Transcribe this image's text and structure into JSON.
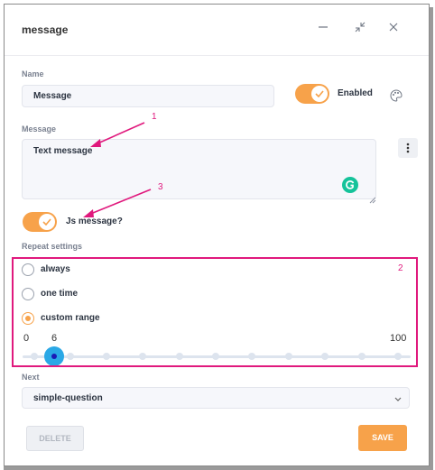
{
  "dialog": {
    "title": "message",
    "window_controls": [
      "minimize",
      "collapse",
      "close"
    ]
  },
  "name_field": {
    "label": "Name",
    "value": "Message"
  },
  "enabled_toggle": {
    "label": "Enabled",
    "on": true
  },
  "message_field": {
    "label": "Message",
    "value": "Text message"
  },
  "js_toggle": {
    "label": "Js message?",
    "on": true
  },
  "repeat": {
    "label": "Repeat settings",
    "options": [
      {
        "label": "always",
        "selected": false
      },
      {
        "label": "one time",
        "selected": false
      },
      {
        "label": "custom range",
        "selected": true
      }
    ],
    "slider": {
      "min": "0",
      "max": "100",
      "value": "6"
    }
  },
  "next_field": {
    "label": "Next",
    "value": "simple-question"
  },
  "buttons": {
    "delete": "DELETE",
    "save": "SAVE"
  },
  "annotations": {
    "n1": "1",
    "n2": "2",
    "n3": "3"
  },
  "colors": {
    "accent": "#f7a24a",
    "annotation": "#e0197d",
    "slider_thumb": "#2aa8e6"
  },
  "icons": [
    "minimize-icon",
    "collapse-icon",
    "close-icon",
    "palette-icon",
    "more-vert-icon",
    "grammarly-icon",
    "check-icon",
    "chevron-down-icon"
  ]
}
